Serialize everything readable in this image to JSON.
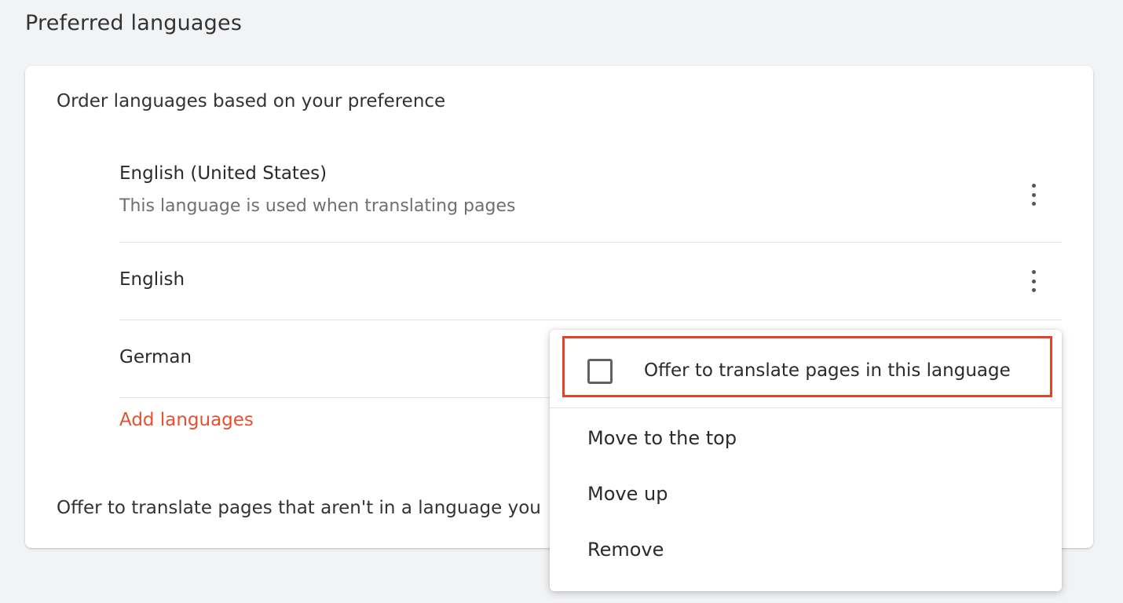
{
  "section": {
    "title": "Preferred languages"
  },
  "card": {
    "order_label": "Order languages based on your preference",
    "languages": [
      {
        "name": "English (United States)",
        "subtitle": "This language is used when translating pages"
      },
      {
        "name": "English",
        "subtitle": ""
      },
      {
        "name": "German",
        "subtitle": ""
      }
    ],
    "add_languages": "Add languages",
    "offer_translate_text": "Offer to translate pages that aren't in a language you"
  },
  "context_menu": {
    "checkbox_label": "Offer to translate pages in this language",
    "checkbox_checked": false,
    "items": [
      "Move to the top",
      "Move up",
      "Remove"
    ]
  },
  "colors": {
    "accent": "#e5502f",
    "highlight": "#e0452a",
    "page_bg": "#f2f3f5"
  }
}
